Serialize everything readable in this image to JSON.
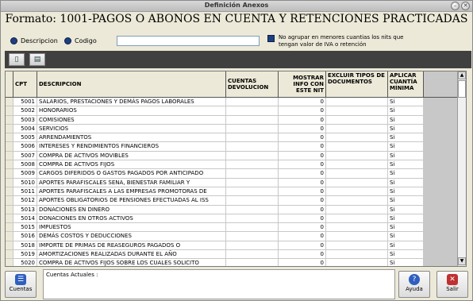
{
  "window": {
    "title": "Definición Anexos"
  },
  "heading": "Formato: 1001-PAGOS O ABONOS EN CUENTA Y RETENCIONES PRACTICADAS",
  "options": {
    "descripcion": "Descripcion",
    "codigo": "Codigo",
    "no_agrupar": "No agrupar en menores cuantias los nits que tengan valor de IVA o retención"
  },
  "table": {
    "headers": {
      "cpt": "CPT",
      "descripcion": "DESCRIPCION",
      "cuentas": "CUENTAS DEVOLUCION",
      "mostrar": "MOSTRAR INFO CON ESTE NIT",
      "excluir": "EXCLUIR TIPOS DE DOCUMENTOS",
      "aplicar": "APLICAR CUANTÍA MÍNIMA"
    },
    "rows": [
      {
        "cpt": "5001",
        "desc": "SALARIOS, PRESTACIONES Y DEMÁS PAGOS LABORALES",
        "mostrar": "0",
        "aplicar": "Si"
      },
      {
        "cpt": "5002",
        "desc": "HONORARIOS",
        "mostrar": "0",
        "aplicar": "Si"
      },
      {
        "cpt": "5003",
        "desc": "COMISIONES",
        "mostrar": "0",
        "aplicar": "Si"
      },
      {
        "cpt": "5004",
        "desc": "SERVICIOS",
        "mostrar": "0",
        "aplicar": "Si"
      },
      {
        "cpt": "5005",
        "desc": "ARRENDAMIENTOS",
        "mostrar": "0",
        "aplicar": "Si"
      },
      {
        "cpt": "5006",
        "desc": "INTERESES Y RENDIMIENTOS FINANCIEROS",
        "mostrar": "0",
        "aplicar": "Si"
      },
      {
        "cpt": "5007",
        "desc": "COMPRA DE ACTIVOS MOVIBLES",
        "mostrar": "0",
        "aplicar": "Si"
      },
      {
        "cpt": "5008",
        "desc": "COMPRA DE ACTIVOS FIJOS",
        "mostrar": "0",
        "aplicar": "Si"
      },
      {
        "cpt": "5009",
        "desc": "CARGOS DIFERIDOS O GASTOS PAGADOS POR ANTICIPADO",
        "mostrar": "0",
        "aplicar": "Si"
      },
      {
        "cpt": "5010",
        "desc": "APORTES PARAFISCALES SENA, BIENESTAR FAMILIAR Y",
        "mostrar": "0",
        "aplicar": "Si"
      },
      {
        "cpt": "5011",
        "desc": "APORTES PARAFISCALES A LAS EMPRESAS PROMOTORAS DE",
        "mostrar": "0",
        "aplicar": "Si"
      },
      {
        "cpt": "5012",
        "desc": "APORTES OBLIGATORIOS DE PENSIONES EFECTUADAS AL ISS",
        "mostrar": "0",
        "aplicar": "Si"
      },
      {
        "cpt": "5013",
        "desc": "DONACIONES EN DINERO",
        "mostrar": "0",
        "aplicar": "Si"
      },
      {
        "cpt": "5014",
        "desc": "DONACIONES EN OTROS ACTIVOS",
        "mostrar": "0",
        "aplicar": "Si"
      },
      {
        "cpt": "5015",
        "desc": "IMPUESTOS",
        "mostrar": "0",
        "aplicar": "Si"
      },
      {
        "cpt": "5016",
        "desc": "DEMÁS COSTOS Y DEDUCCIONES",
        "mostrar": "0",
        "aplicar": "Si"
      },
      {
        "cpt": "5018",
        "desc": "IMPORTE DE PRIMAS DE REASEGUROS PAGADOS O",
        "mostrar": "0",
        "aplicar": "Si"
      },
      {
        "cpt": "5019",
        "desc": "AMORTIZACIONES REALIZADAS DURANTE EL AÑO",
        "mostrar": "0",
        "aplicar": "Si"
      },
      {
        "cpt": "5020",
        "desc": "COMPRA DE ACTIVOS FIJOS SOBRE LOS CUALES SOLICITO",
        "mostrar": "0",
        "aplicar": "Si"
      }
    ]
  },
  "footer": {
    "cuentas_label": "Cuentas",
    "notes_label": "Cuentas Actuales :",
    "ayuda_label": "Ayuda",
    "salir_label": "Salir"
  }
}
